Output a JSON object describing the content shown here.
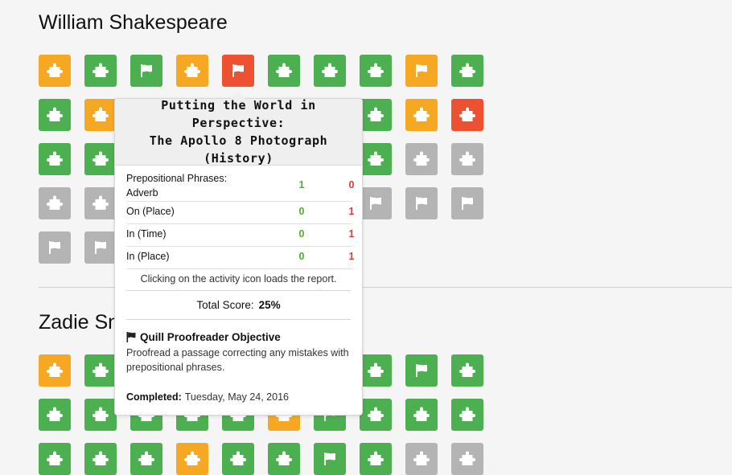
{
  "students": [
    {
      "name": "William Shakespeare",
      "rows": [
        [
          {
            "c": "o",
            "i": "puzzle"
          },
          {
            "c": "g",
            "i": "puzzle"
          },
          {
            "c": "g",
            "i": "flag"
          },
          {
            "c": "o",
            "i": "puzzle"
          },
          {
            "c": "r",
            "i": "flag"
          },
          {
            "c": "g",
            "i": "puzzle"
          },
          {
            "c": "g",
            "i": "puzzle"
          },
          {
            "c": "g",
            "i": "puzzle"
          },
          {
            "c": "o",
            "i": "flag"
          },
          {
            "c": "g",
            "i": "puzzle"
          }
        ],
        [
          {
            "c": "g",
            "i": "puzzle"
          },
          {
            "c": "o",
            "i": "puzzle"
          },
          null,
          null,
          null,
          null,
          null,
          {
            "c": "g",
            "i": "puzzle"
          },
          {
            "c": "o",
            "i": "puzzle"
          },
          {
            "c": "r",
            "i": "puzzle"
          }
        ],
        [
          {
            "c": "g",
            "i": "puzzle"
          },
          {
            "c": "g",
            "i": "puzzle"
          },
          null,
          null,
          null,
          null,
          null,
          {
            "c": "g",
            "i": "puzzle"
          },
          {
            "c": "n",
            "i": "puzzle"
          },
          {
            "c": "n",
            "i": "puzzle"
          }
        ],
        [
          {
            "c": "n",
            "i": "puzzle"
          },
          {
            "c": "n",
            "i": "puzzle"
          },
          null,
          null,
          null,
          null,
          null,
          {
            "c": "n",
            "i": "flag"
          },
          {
            "c": "n",
            "i": "flag"
          },
          {
            "c": "n",
            "i": "flag"
          }
        ],
        [
          {
            "c": "n",
            "i": "flag"
          },
          {
            "c": "n",
            "i": "flag"
          }
        ]
      ]
    },
    {
      "name": "Zadie Smith",
      "rows": [
        [
          {
            "c": "o",
            "i": "puzzle"
          },
          {
            "c": "g",
            "i": "puzzle"
          },
          null,
          null,
          null,
          null,
          null,
          {
            "c": "g",
            "i": "puzzle"
          },
          {
            "c": "g",
            "i": "flag"
          },
          {
            "c": "g",
            "i": "puzzle"
          }
        ],
        [
          {
            "c": "g",
            "i": "puzzle"
          },
          {
            "c": "g",
            "i": "puzzle"
          },
          {
            "c": "g",
            "i": "puzzle"
          },
          {
            "c": "g",
            "i": "puzzle"
          },
          {
            "c": "g",
            "i": "puzzle"
          },
          {
            "c": "o",
            "i": "puzzle"
          },
          {
            "c": "g",
            "i": "flag"
          },
          {
            "c": "g",
            "i": "puzzle"
          },
          {
            "c": "g",
            "i": "puzzle"
          },
          {
            "c": "g",
            "i": "puzzle"
          }
        ],
        [
          {
            "c": "g",
            "i": "puzzle"
          },
          {
            "c": "g",
            "i": "puzzle"
          },
          {
            "c": "g",
            "i": "puzzle"
          },
          {
            "c": "o",
            "i": "puzzle"
          },
          {
            "c": "g",
            "i": "puzzle"
          },
          {
            "c": "g",
            "i": "puzzle"
          },
          {
            "c": "g",
            "i": "flag"
          },
          {
            "c": "g",
            "i": "puzzle"
          },
          {
            "c": "n",
            "i": "puzzle"
          },
          {
            "c": "n",
            "i": "puzzle"
          }
        ]
      ]
    }
  ],
  "colors": {
    "g": "#4caf50",
    "o": "#f7a823",
    "r": "#ee5032",
    "n": "#b4b4b4"
  },
  "tooltip": {
    "title_line1": "Putting the World in Perspective:",
    "title_line2": "The Apollo 8 Photograph",
    "title_line3": "(History)",
    "concepts": [
      {
        "name": "Prepositional Phrases: Adverb",
        "correct": "1",
        "incorrect": "0"
      },
      {
        "name": "On (Place)",
        "correct": "0",
        "incorrect": "1"
      },
      {
        "name": "In (Time)",
        "correct": "0",
        "incorrect": "1"
      },
      {
        "name": "In (Place)",
        "correct": "0",
        "incorrect": "1"
      }
    ],
    "note": "Clicking on the activity icon loads the report.",
    "score_label": "Total Score:",
    "score_value": "25%",
    "objective_title": "Quill Proofreader Objective",
    "objective_desc": "Proofread a passage correcting any mistakes with prepositional phrases.",
    "completed_label": "Completed:",
    "completed_date": "Tuesday, May 24, 2016"
  }
}
